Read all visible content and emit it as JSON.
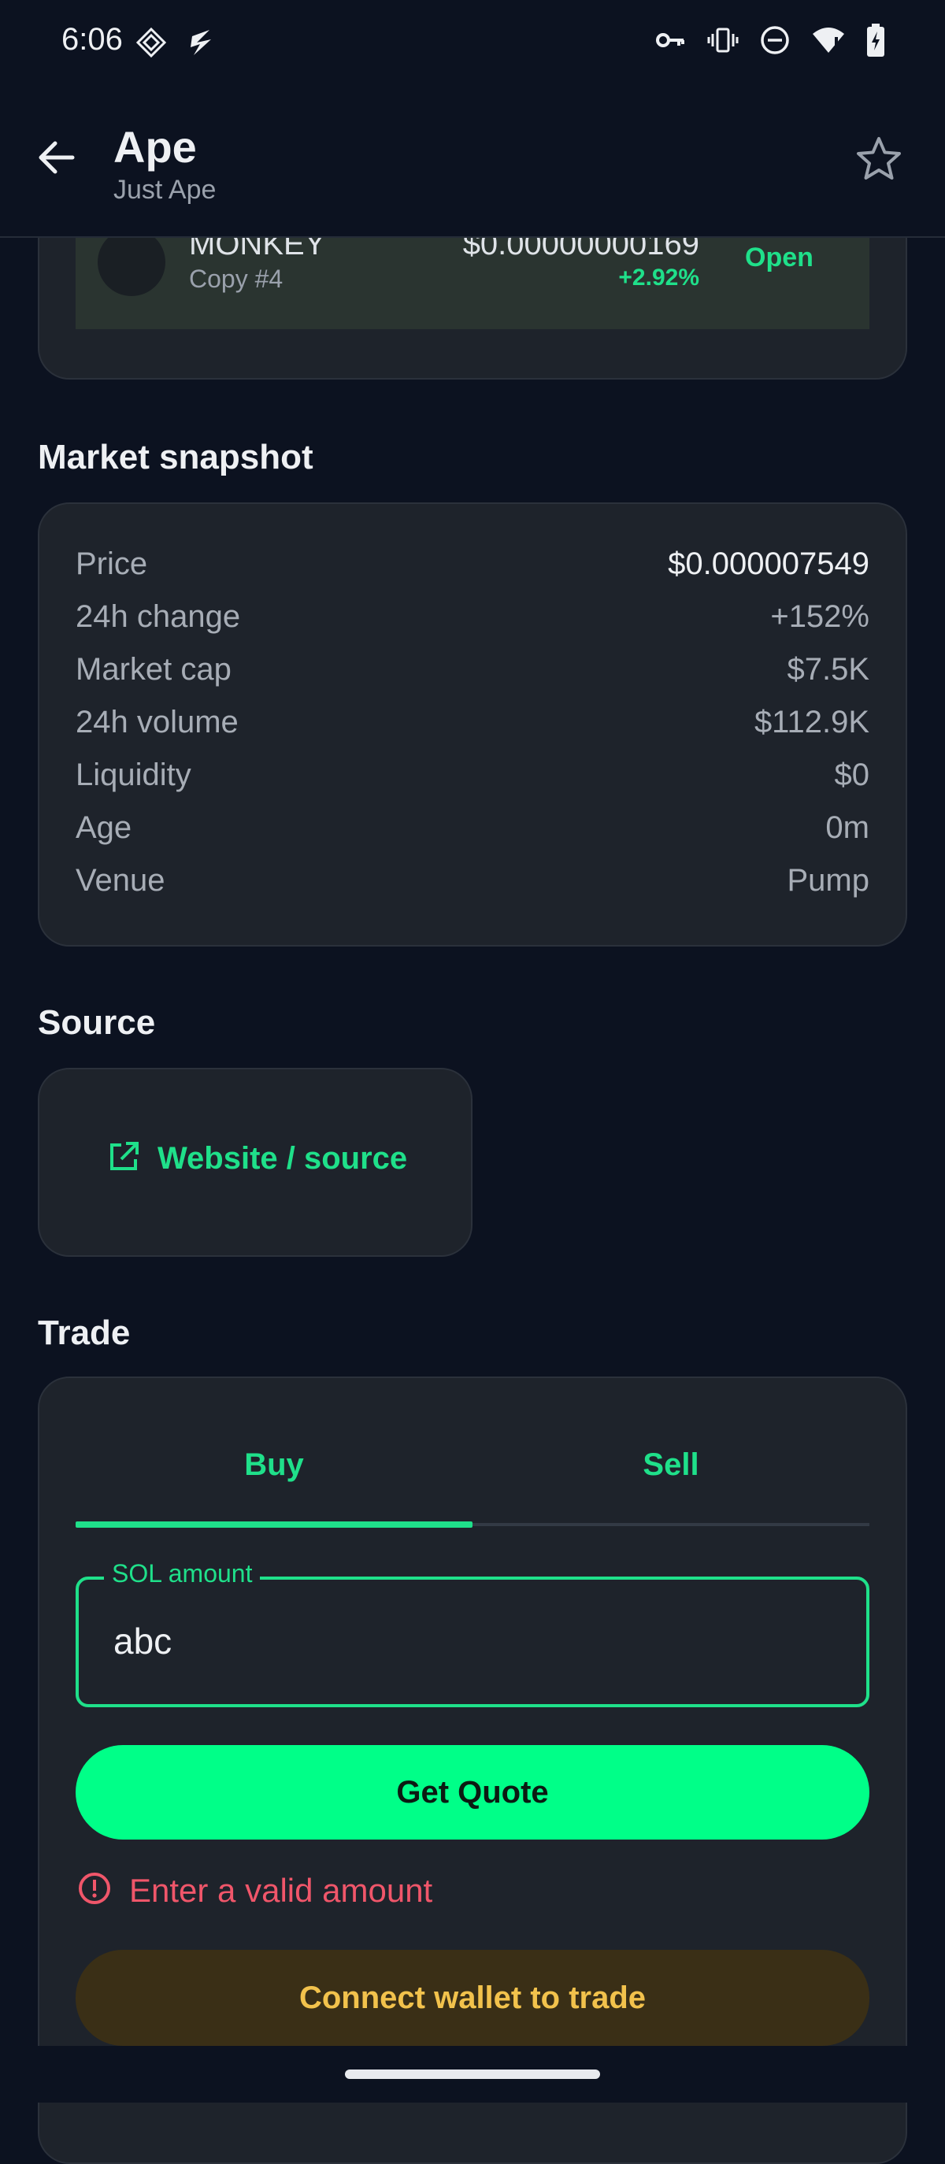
{
  "status_bar": {
    "time": "6:06",
    "icons": [
      "diamond-icon",
      "bolt-icon",
      "vpn-key-icon",
      "vibrate-icon",
      "dnd-icon",
      "wifi-alert-icon",
      "battery-charging-icon"
    ]
  },
  "header": {
    "title": "Ape",
    "subtitle": "Just Ape",
    "back_icon": "arrow-left-icon",
    "favorite_icon": "star-outline-icon"
  },
  "copy_card": {
    "name": "MONKEY",
    "sub": "Copy #4",
    "price": "$0.00000000169",
    "change": "+2.92%",
    "status": "Open"
  },
  "market_snapshot": {
    "title": "Market snapshot",
    "rows": [
      {
        "label": "Price",
        "value": "$0.000007549"
      },
      {
        "label": "24h change",
        "value": "+152%"
      },
      {
        "label": "Market cap",
        "value": "$7.5K"
      },
      {
        "label": "24h volume",
        "value": "$112.9K"
      },
      {
        "label": "Liquidity",
        "value": "$0"
      },
      {
        "label": "Age",
        "value": "0m"
      },
      {
        "label": "Venue",
        "value": "Pump"
      }
    ]
  },
  "source": {
    "title": "Source",
    "link_label": "Website / source",
    "link_icon": "open-external-icon"
  },
  "trade": {
    "title": "Trade",
    "tabs": [
      {
        "label": "Buy",
        "selected": true
      },
      {
        "label": "Sell",
        "selected": false
      }
    ],
    "amount_label": "SOL amount",
    "amount_value": "abc",
    "quote_button": "Get Quote",
    "error_text": "Enter a valid amount",
    "wallet_button": "Connect wallet to trade"
  },
  "colors": {
    "background": "#0c1220",
    "card": "#1e232b",
    "accent": "#1fe08a",
    "button": "#00ff88",
    "error": "#f0566a",
    "warning_text": "#f2c24c",
    "warning_bg": "#3a2f16"
  }
}
